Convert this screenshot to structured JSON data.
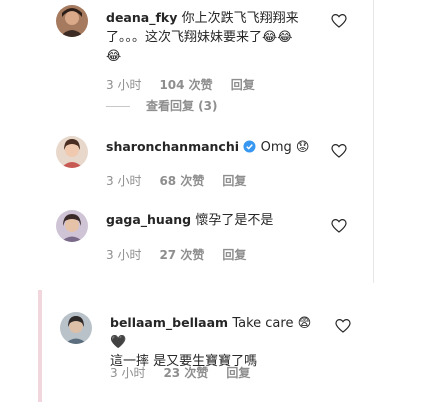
{
  "colors": {
    "text": "#262626",
    "muted": "#8e8e8e",
    "verified": "#3897f0",
    "highlight_rule": "#f2d6dd"
  },
  "comments": [
    {
      "username": "deana_fky",
      "line1": "你上次跌飞飞翔翔来",
      "line2": "了。。。这次飞翔妹妹要来了😂😂",
      "line3": "😂",
      "time": "3 小时",
      "likes": "104 次赞",
      "reply": "回复",
      "view_replies": "查看回复 (3)",
      "icons": [
        "heart-icon"
      ]
    },
    {
      "username": "sharonchanmanchi",
      "message": "Omg 😟",
      "verified": true,
      "time": "3 小时",
      "likes": "68 次赞",
      "reply": "回复",
      "icons": [
        "verified-icon",
        "heart-icon"
      ]
    },
    {
      "username": "gaga_huang",
      "message": "懷孕了是不是",
      "time": "3 小时",
      "likes": "27 次赞",
      "reply": "回复",
      "icons": [
        "heart-icon"
      ]
    },
    {
      "username": "bellaam_bellaam",
      "message": "Take care 😨🖤",
      "line2": "這一摔 是又要生寶寶了嗎",
      "time": "3 小时",
      "likes": "23 次赞",
      "reply": "回复",
      "icons": [
        "heart-icon"
      ]
    }
  ]
}
